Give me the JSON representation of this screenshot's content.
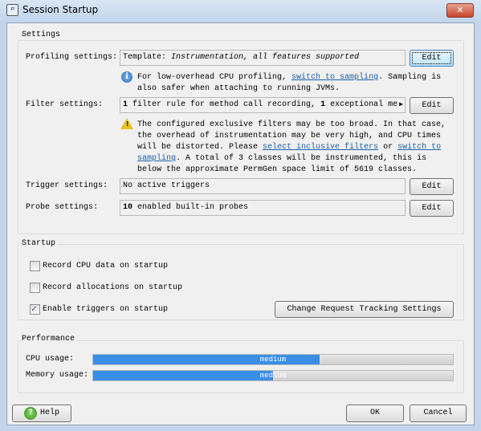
{
  "window": {
    "title": "Session Startup",
    "icon": "profiler-app-icon",
    "close_icon": "close-icon"
  },
  "settings": {
    "label": "Settings",
    "profiling": {
      "label": "Profiling settings:",
      "value_prefix": "Template:",
      "value_italic": "Instrumentation, all features supported",
      "edit": "Edit"
    },
    "info": {
      "icon": "info-icon",
      "text1": "For low-overhead CPU profiling,",
      "link": "switch to sampling",
      "text2": ". Sampling is also safer when attaching to running JVMs."
    },
    "filter": {
      "label": "Filter settings:",
      "bold1": "1",
      "text1": " filter rule for method call recording, ",
      "bold2": "1",
      "text2": " exceptional me",
      "more_icon": "triangle-right-icon",
      "edit": "Edit"
    },
    "warning": {
      "icon": "warning-icon",
      "text1": "The configured exclusive filters may be too broad. In that case, the overhead of instrumentation may be very high, and CPU times will be distorted. Please ",
      "link1": "select inclusive filters",
      "text2": " or ",
      "link2": "switch to sampling",
      "text3": ". A total of 3 classes will be instrumented, this is below the approximate PermGen space limit of 5619 classes."
    },
    "trigger": {
      "label": "Trigger settings:",
      "value": "No active triggers",
      "edit": "Edit"
    },
    "probe": {
      "label": "Probe settings:",
      "bold": "10",
      "value": " enabled built-in probes",
      "edit": "Edit"
    }
  },
  "startup": {
    "label": "Startup",
    "options": [
      {
        "label": "Record CPU data on startup",
        "checked": false
      },
      {
        "label": "Record allocations on startup",
        "checked": false
      },
      {
        "label": "Enable triggers on startup",
        "checked": true
      }
    ],
    "tracking_button": "Change Request Tracking Settings"
  },
  "performance": {
    "label": "Performance",
    "cpu": {
      "label": "CPU usage:",
      "text": "medium",
      "level_percent": 63
    },
    "memory": {
      "label": "Memory usage:",
      "text": "medium",
      "level_percent": 50
    },
    "bar_color": "#3a8ee6"
  },
  "footer": {
    "help": "Help",
    "help_icon": "help-icon",
    "ok": "OK",
    "cancel": "Cancel"
  }
}
